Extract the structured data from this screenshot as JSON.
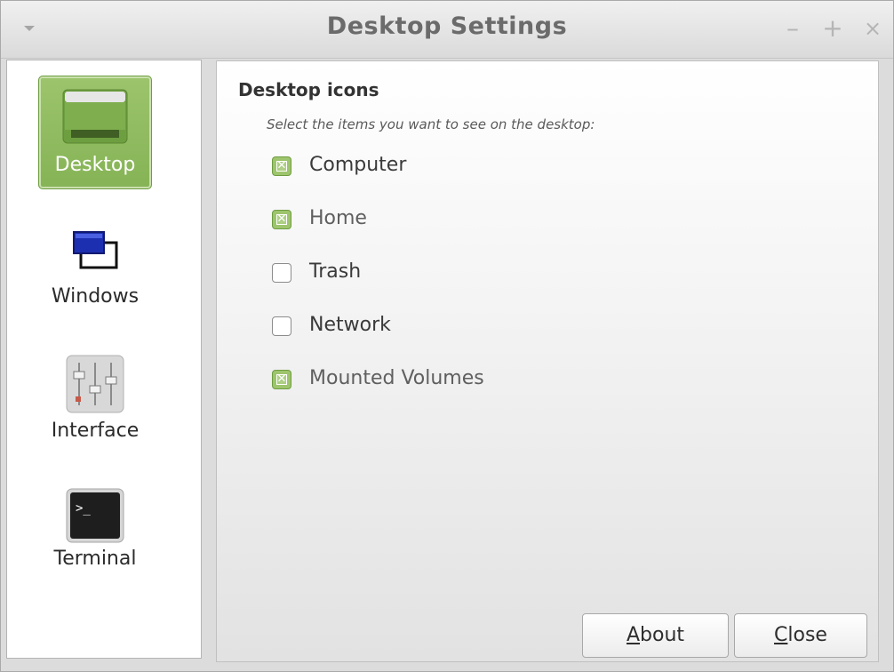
{
  "window": {
    "title": "Desktop Settings",
    "controls": {
      "minimize": "–",
      "maximize": "+",
      "close": "×"
    }
  },
  "sidebar": {
    "items": [
      {
        "label": "Desktop",
        "icon": "desktop-icon",
        "active": true
      },
      {
        "label": "Windows",
        "icon": "windows-icon",
        "active": false
      },
      {
        "label": "Interface",
        "icon": "interface-icon",
        "active": false
      },
      {
        "label": "Terminal",
        "icon": "terminal-icon",
        "active": false
      }
    ]
  },
  "main": {
    "section_title": "Desktop icons",
    "description": "Select the items you want to see on the desktop:",
    "options": [
      {
        "label": "Computer",
        "checked": true
      },
      {
        "label": "Home",
        "checked": true
      },
      {
        "label": "Trash",
        "checked": false
      },
      {
        "label": "Network",
        "checked": false
      },
      {
        "label": "Mounted Volumes",
        "checked": true
      }
    ]
  },
  "buttons": {
    "about_first": "A",
    "about_rest": "bout",
    "close_first": "C",
    "close_rest": "lose"
  },
  "colors": {
    "accent": "#8cbc5a",
    "check_green": "#9ec56d"
  }
}
